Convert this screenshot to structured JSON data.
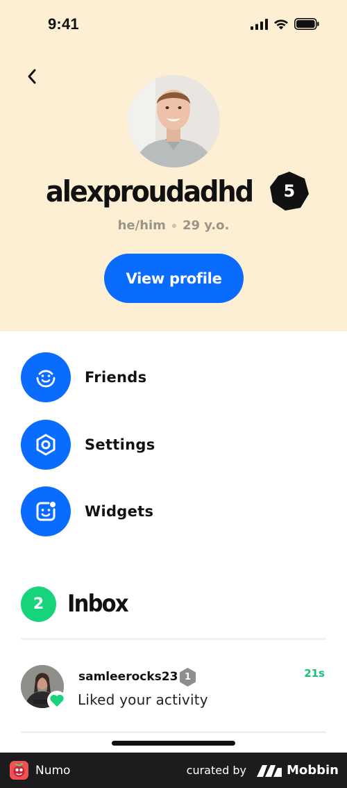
{
  "status_bar": {
    "time": "9:41"
  },
  "profile": {
    "username": "alexproudadhd",
    "level": "5",
    "pronouns": "he/him",
    "age": "29 y.o.",
    "view_profile_label": "View profile"
  },
  "menu": {
    "items": [
      {
        "label": "Friends",
        "icon": "smiley-icon"
      },
      {
        "label": "Settings",
        "icon": "gear-icon"
      },
      {
        "label": "Widgets",
        "icon": "widget-face-icon"
      }
    ]
  },
  "inbox": {
    "title": "Inbox",
    "count": "2",
    "items": [
      {
        "username": "samleerocks23",
        "level": "1",
        "message": "Liked your activity",
        "time": "21s"
      }
    ]
  },
  "footer": {
    "app_name": "Numo",
    "curated_by": "curated by",
    "brand": "Mobbin"
  },
  "colors": {
    "hero_background": "#fdefd3",
    "accent_blue": "#0a6bff",
    "accent_green": "#16d47b"
  }
}
